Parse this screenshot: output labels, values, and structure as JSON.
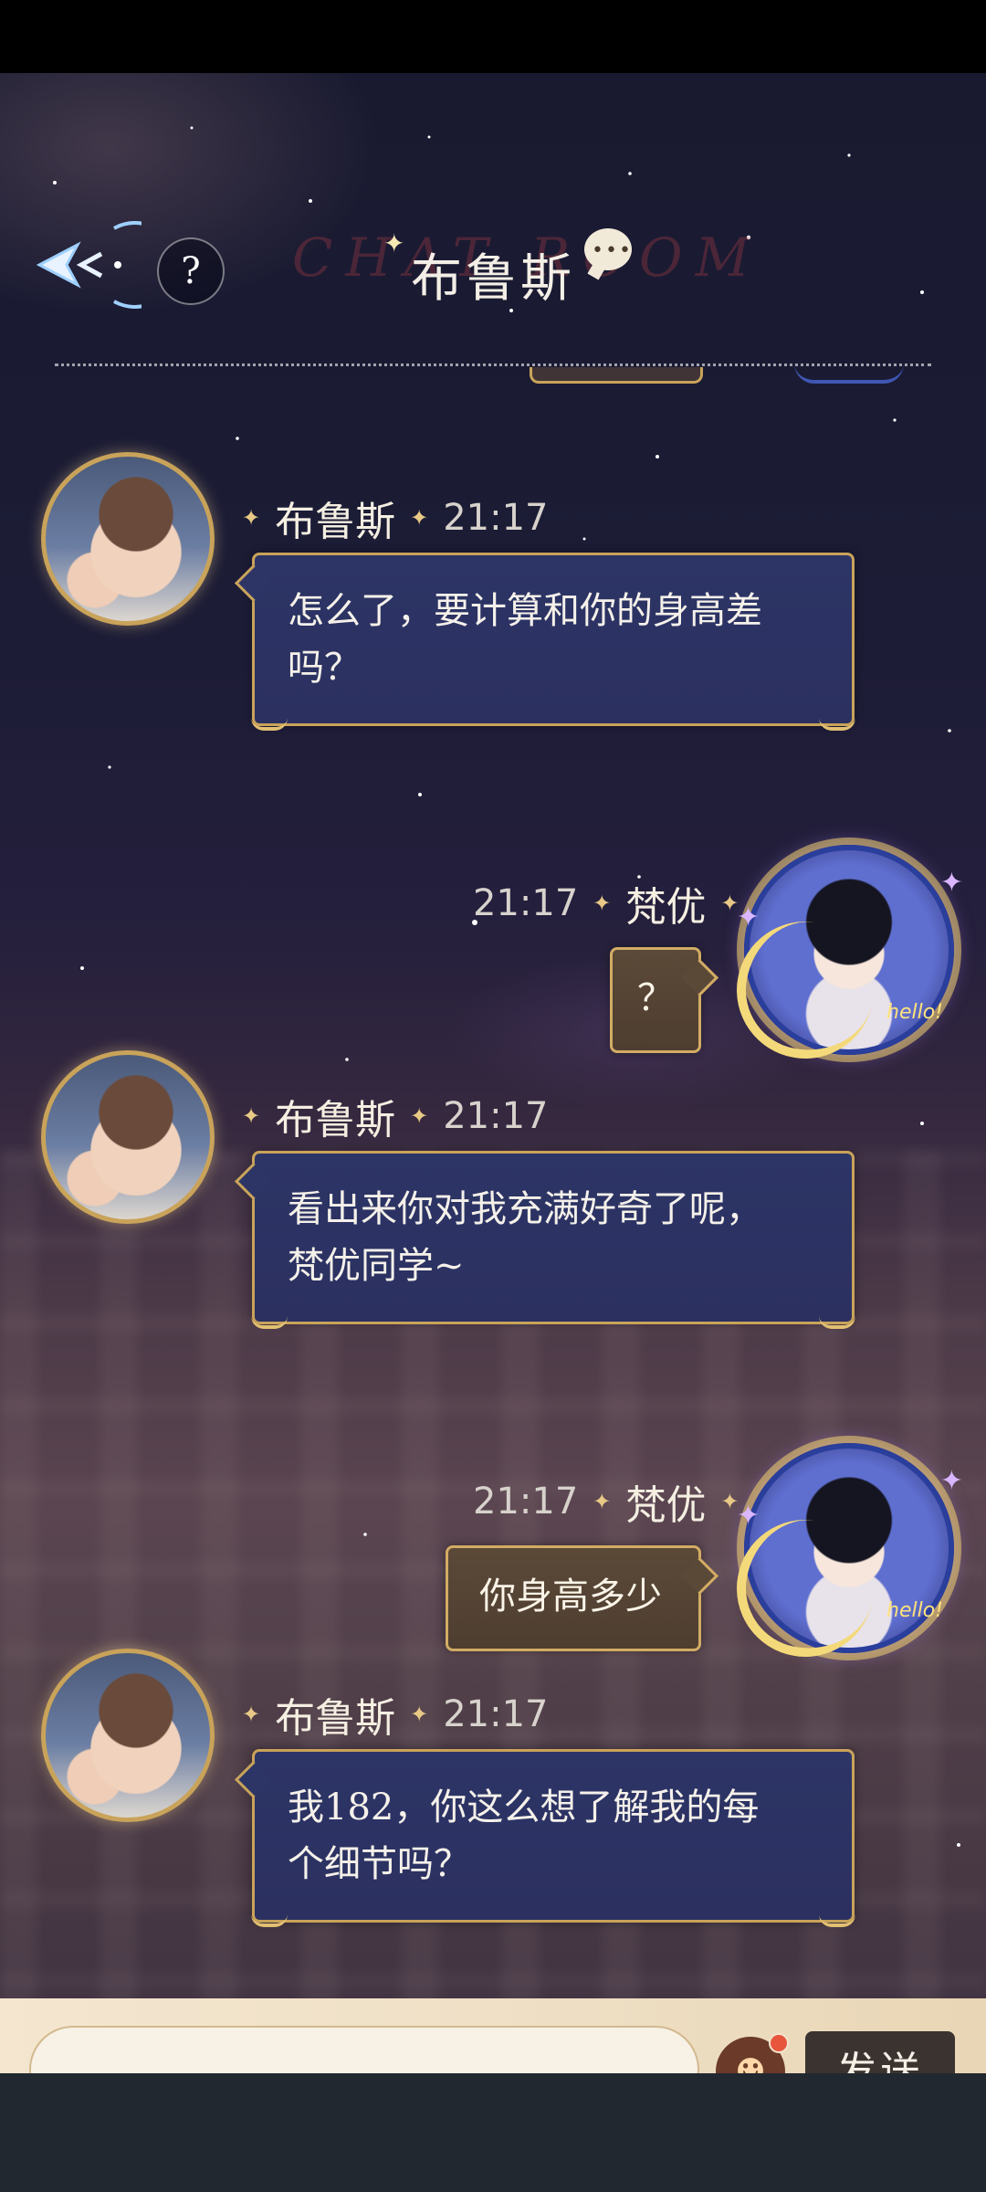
{
  "header": {
    "title": "布鲁斯",
    "watermark": "CHAT ROOM",
    "help_label": "?"
  },
  "messages": [
    {
      "side": "in",
      "name": "布鲁斯",
      "time": "21:17",
      "lines": [
        "怎么了，要计算和你的身高差",
        "吗？"
      ]
    },
    {
      "side": "out",
      "name": "梵优",
      "time": "21:17",
      "lines": [
        "？"
      ]
    },
    {
      "side": "in",
      "name": "布鲁斯",
      "time": "21:17",
      "lines": [
        "看出来你对我充满好奇了呢，",
        "梵优同学~"
      ]
    },
    {
      "side": "out",
      "name": "梵优",
      "time": "21:17",
      "lines": [
        "你身高多少"
      ]
    },
    {
      "side": "in",
      "name": "布鲁斯",
      "time": "21:17",
      "lines": [
        "我182，你这么想了解我的每",
        "个细节吗？"
      ]
    }
  ],
  "avatar_badge_text": "hello!",
  "input": {
    "value": "",
    "placeholder": ""
  },
  "send_label": "发送",
  "icons": {
    "back": "back-arrow-icon",
    "help": "question-mark-icon",
    "chat": "chat-bubble-icon",
    "emoji": "smiley-face-icon"
  },
  "colors": {
    "incoming_bubble": "#2d3566",
    "outgoing_bubble": "#5b4938",
    "gold_border": "#c9a35a",
    "input_bar": "#efe0c6",
    "send_button": "#3a3330"
  }
}
